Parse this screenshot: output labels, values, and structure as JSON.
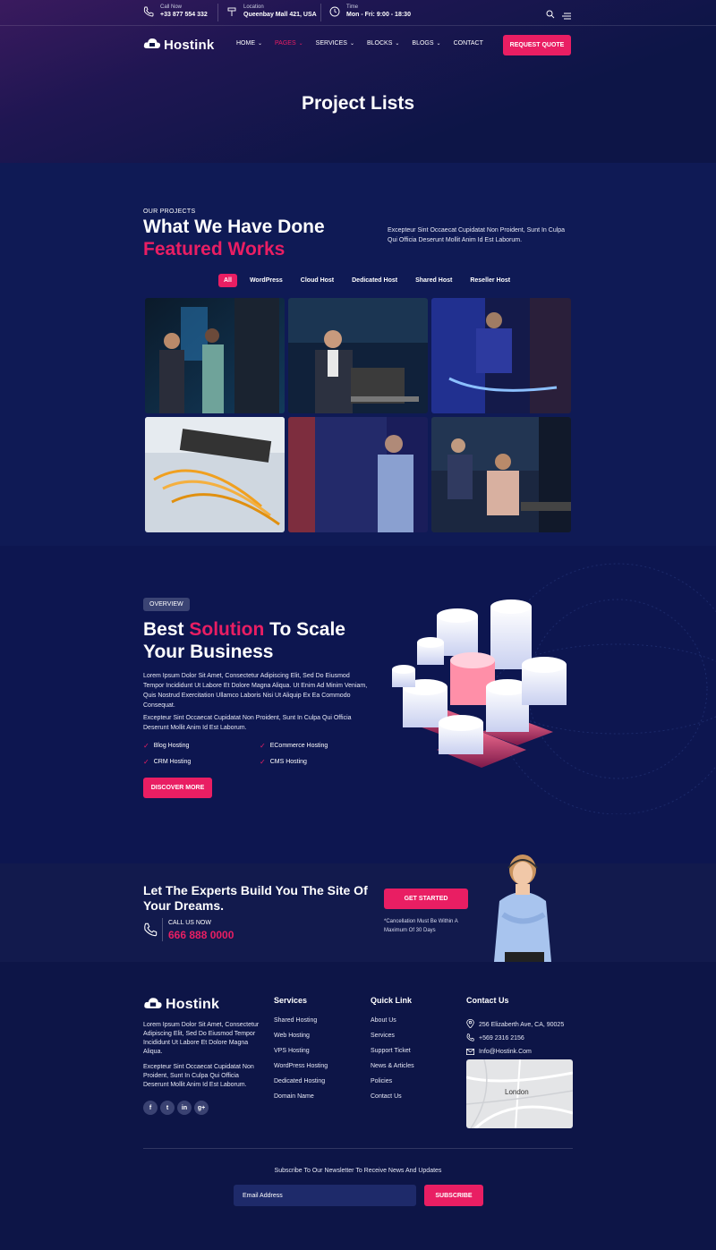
{
  "topbar": {
    "call": {
      "label": "Call Now",
      "value": "+33 877 554 332"
    },
    "location": {
      "label": "Location",
      "value": "Queenbay Mall 421, USA"
    },
    "time": {
      "label": "Time",
      "value": "Mon - Fri: 9:00 - 18:30"
    },
    "icons": [
      "search-icon",
      "menu-icon"
    ]
  },
  "header": {
    "logo": "Hostink",
    "nav": [
      {
        "label": "HOME",
        "dropdown": true
      },
      {
        "label": "PAGES",
        "dropdown": true,
        "active": true
      },
      {
        "label": "SERVICES",
        "dropdown": true
      },
      {
        "label": "BLOCKS",
        "dropdown": true
      },
      {
        "label": "BLOGS",
        "dropdown": true
      },
      {
        "label": "CONTACT",
        "dropdown": false
      }
    ],
    "cta": "REQUEST QUOTE"
  },
  "hero": {
    "title": "Project Lists"
  },
  "projects": {
    "eyebrow": "OUR PROJECTS",
    "title_line1": "What We Have Done",
    "title_line2": "Featured Works",
    "description": "Excepteur Sint Occaecat Cupidatat Non Proident, Sunt In Culpa Qui Officia Deserunt Mollit Anim Id Est Laborum.",
    "filters": [
      "All",
      "WordPress",
      "Cloud Host",
      "Dedicated Host",
      "Shared Host",
      "Reseller Host"
    ],
    "active_filter": "All"
  },
  "overview": {
    "badge": "OVERVIEW",
    "title_a": "Best ",
    "title_highlight": "Solution",
    "title_b": " To Scale",
    "title_line2": "Your Business",
    "para1": "Lorem Ipsum Dolor Sit Amet, Consectetur Adipiscing Elit, Sed Do Eiusmod Tempor Incididunt Ut Labore Et Dolore Magna Aliqua. Ut Enim Ad Minim Veniam, Quis Nostrud Exercitation Ullamco Laboris Nisi Ut Aliquip Ex Ea Commodo Consequat.",
    "para2": "Excepteur Sint Occaecat Cupidatat Non Proident, Sunt In Culpa Qui Officia Deserunt Mollit Anim Id Est Laborum.",
    "features": [
      "Blog Hosting",
      "ECommerce Hosting",
      "CRM Hosting",
      "CMS Hosting"
    ],
    "button": "DISCOVER MORE"
  },
  "cta": {
    "title": "Let The Experts Build You The Site Of Your Dreams.",
    "call_label": "CALL US NOW",
    "phone": "666 888 0000",
    "button": "GET STARTED",
    "note": "*Cancellation Must Be Within A Maximum Of 30 Days"
  },
  "footer": {
    "logo": "Hostink",
    "about1": "Lorem Ipsum Dolor Sit Amet, Consectetur Adipiscing Elit, Sed Do Eiusmod Tempor Incididunt Ut Labore Et Dolore Magna Aliqua.",
    "about2": "Excepteur Sint Occaecat Cupidatat Non Proident, Sunt In Culpa Qui Officia Deserunt Mollit Anim Id Est Laborum.",
    "social": [
      "f",
      "t",
      "in",
      "g+"
    ],
    "services_title": "Services",
    "services": [
      "Shared Hosting",
      "Web Hosting",
      "VPS Hosting",
      "WordPress Hosting",
      "Dedicated Hosting",
      "Domain Name"
    ],
    "quick_title": "Quick Link",
    "quick": [
      "About Us",
      "Services",
      "Support Ticket",
      "News & Articles",
      "Policies",
      "Contact Us"
    ],
    "contact_title": "Contact Us",
    "address": "256 Elizaberth Ave, CA, 90025",
    "phone": "+569 2316 2156",
    "email": "Info@Hostink.Com",
    "map_label": "London",
    "newsletter_text": "Subscribe To Our Newsletter To Receive News And Updates",
    "email_placeholder": "Email Address",
    "subscribe": "SUBSCRIBE"
  },
  "colors": {
    "accent": "#e91e63",
    "background": "#0d1547"
  }
}
